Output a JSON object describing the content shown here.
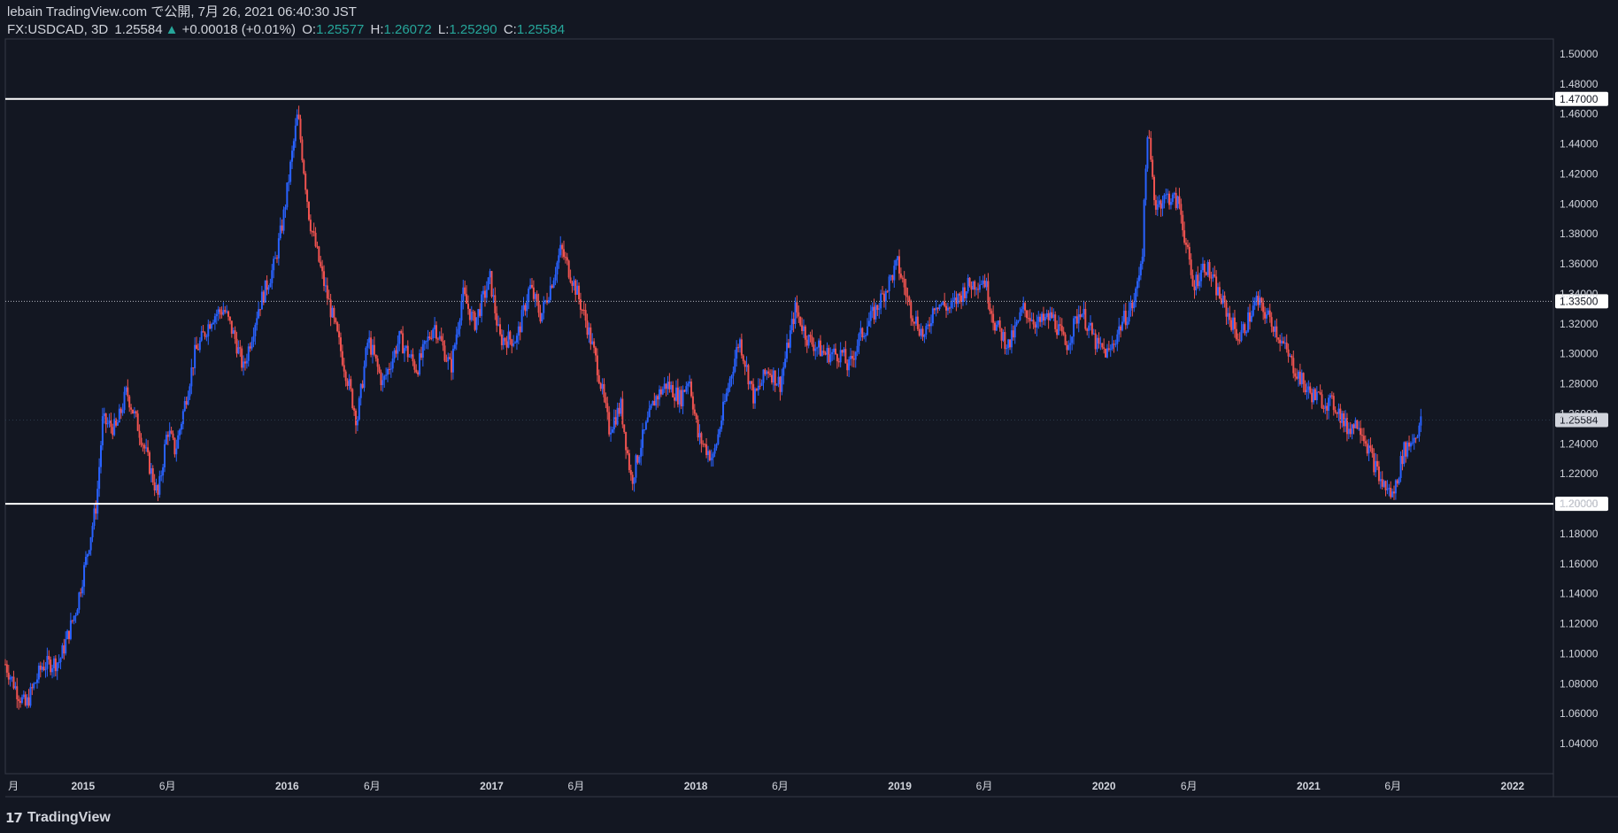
{
  "header": {
    "publish_line": "lebain TradingView.com で公開, 7月 26, 2021 06:40:30 JST",
    "symbol": "FX:USDCAD, 3D",
    "last": "1.25584",
    "change_arrow": "▲",
    "change": "+0.00018 (+0.01%)",
    "o_label": "O:",
    "o_val": "1.25577",
    "h_label": "H:",
    "h_val": "1.26072",
    "l_label": "L:",
    "l_val": "1.25290",
    "c_label": "C:",
    "c_val": "1.25584"
  },
  "footer": {
    "logo_text": "TradingView",
    "logo_icon": "tradingview-logo-icon"
  },
  "colors": {
    "background": "#131722",
    "up": "#2962ff",
    "down": "#ef5350",
    "grid": "#2a2e39",
    "text": "#d1d4dc"
  },
  "chart_data": {
    "type": "candlestick",
    "symbol": "FX:USDCAD",
    "interval": "3D",
    "ylim": [
      1.02,
      1.51
    ],
    "xlim": [
      "2014-08-15",
      "2022-03-15"
    ],
    "y_ticks": [
      "1.04000",
      "1.06000",
      "1.08000",
      "1.10000",
      "1.12000",
      "1.14000",
      "1.16000",
      "1.18000",
      "1.20000",
      "1.22000",
      "1.24000",
      "1.26000",
      "1.28000",
      "1.30000",
      "1.32000",
      "1.34000",
      "1.36000",
      "1.38000",
      "1.40000",
      "1.42000",
      "1.44000",
      "1.46000",
      "1.48000",
      "1.50000"
    ],
    "x_ticks": [
      {
        "date": "2014-08-20",
        "label": "月"
      },
      {
        "date": "2015-01-01",
        "label": "2015"
      },
      {
        "date": "2015-06-01",
        "label": "6月"
      },
      {
        "date": "2016-01-01",
        "label": "2016"
      },
      {
        "date": "2016-06-01",
        "label": "6月"
      },
      {
        "date": "2017-01-01",
        "label": "2017"
      },
      {
        "date": "2017-06-01",
        "label": "6月"
      },
      {
        "date": "2018-01-01",
        "label": "2018"
      },
      {
        "date": "2018-06-01",
        "label": "6月"
      },
      {
        "date": "2019-01-01",
        "label": "2019"
      },
      {
        "date": "2019-06-01",
        "label": "6月"
      },
      {
        "date": "2020-01-01",
        "label": "2020"
      },
      {
        "date": "2020-06-01",
        "label": "6月"
      },
      {
        "date": "2021-01-01",
        "label": "2021"
      },
      {
        "date": "2021-06-01",
        "label": "6月"
      },
      {
        "date": "2022-01-01",
        "label": "2022"
      }
    ],
    "horizontal_lines": [
      {
        "price": 1.47,
        "label": "1.47000",
        "style": "solid"
      },
      {
        "price": 1.335,
        "label": "1.33500",
        "style": "dotted"
      },
      {
        "price": 1.2,
        "label": "1.20000",
        "style": "solid"
      }
    ],
    "last_price": {
      "price": 1.25584,
      "label": "1.25584"
    },
    "path_points": [
      [
        "2014-08-15",
        1.093
      ],
      [
        "2014-09-05",
        1.075
      ],
      [
        "2014-09-20",
        1.065
      ],
      [
        "2014-10-20",
        1.092
      ],
      [
        "2014-11-20",
        1.095
      ],
      [
        "2014-12-20",
        1.13
      ],
      [
        "2015-01-05",
        1.16
      ],
      [
        "2015-01-25",
        1.2
      ],
      [
        "2015-02-05",
        1.255
      ],
      [
        "2015-03-01",
        1.25
      ],
      [
        "2015-03-20",
        1.275
      ],
      [
        "2015-04-15",
        1.245
      ],
      [
        "2015-05-15",
        1.205
      ],
      [
        "2015-06-01",
        1.25
      ],
      [
        "2015-06-15",
        1.235
      ],
      [
        "2015-07-20",
        1.3
      ],
      [
        "2015-08-20",
        1.325
      ],
      [
        "2015-09-10",
        1.33
      ],
      [
        "2015-09-30",
        1.31
      ],
      [
        "2015-10-15",
        1.29
      ],
      [
        "2015-11-10",
        1.33
      ],
      [
        "2015-12-10",
        1.36
      ],
      [
        "2015-12-25",
        1.39
      ],
      [
        "2016-01-20",
        1.46
      ],
      [
        "2016-02-10",
        1.39
      ],
      [
        "2016-03-05",
        1.35
      ],
      [
        "2016-04-01",
        1.31
      ],
      [
        "2016-04-20",
        1.28
      ],
      [
        "2016-05-05",
        1.255
      ],
      [
        "2016-05-25",
        1.31
      ],
      [
        "2016-06-20",
        1.28
      ],
      [
        "2016-07-20",
        1.31
      ],
      [
        "2016-08-20",
        1.29
      ],
      [
        "2016-09-20",
        1.32
      ],
      [
        "2016-10-20",
        1.29
      ],
      [
        "2016-11-10",
        1.34
      ],
      [
        "2016-12-01",
        1.32
      ],
      [
        "2016-12-29",
        1.35
      ],
      [
        "2017-01-15",
        1.31
      ],
      [
        "2017-02-15",
        1.31
      ],
      [
        "2017-03-10",
        1.345
      ],
      [
        "2017-03-30",
        1.325
      ],
      [
        "2017-04-20",
        1.35
      ],
      [
        "2017-05-05",
        1.37
      ],
      [
        "2017-05-30",
        1.345
      ],
      [
        "2017-06-20",
        1.32
      ],
      [
        "2017-07-10",
        1.29
      ],
      [
        "2017-07-30",
        1.25
      ],
      [
        "2017-08-20",
        1.265
      ],
      [
        "2017-09-08",
        1.215
      ],
      [
        "2017-09-25",
        1.24
      ],
      [
        "2017-10-20",
        1.27
      ],
      [
        "2017-11-10",
        1.28
      ],
      [
        "2017-12-05",
        1.27
      ],
      [
        "2017-12-20",
        1.285
      ],
      [
        "2018-01-05",
        1.245
      ],
      [
        "2018-02-01",
        1.23
      ],
      [
        "2018-03-01",
        1.28
      ],
      [
        "2018-03-20",
        1.31
      ],
      [
        "2018-04-15",
        1.27
      ],
      [
        "2018-05-10",
        1.29
      ],
      [
        "2018-06-01",
        1.28
      ],
      [
        "2018-06-28",
        1.33
      ],
      [
        "2018-07-20",
        1.31
      ],
      [
        "2018-08-20",
        1.3
      ],
      [
        "2018-09-20",
        1.3
      ],
      [
        "2018-10-01",
        1.29
      ],
      [
        "2018-10-20",
        1.31
      ],
      [
        "2018-11-20",
        1.33
      ],
      [
        "2018-12-28",
        1.36
      ],
      [
        "2019-01-20",
        1.33
      ],
      [
        "2019-02-15",
        1.31
      ],
      [
        "2019-03-05",
        1.335
      ],
      [
        "2019-04-01",
        1.33
      ],
      [
        "2019-05-01",
        1.345
      ],
      [
        "2019-06-01",
        1.35
      ],
      [
        "2019-06-20",
        1.32
      ],
      [
        "2019-07-15",
        1.305
      ],
      [
        "2019-08-10",
        1.33
      ],
      [
        "2019-09-05",
        1.32
      ],
      [
        "2019-10-01",
        1.325
      ],
      [
        "2019-10-25",
        1.305
      ],
      [
        "2019-11-20",
        1.33
      ],
      [
        "2019-12-20",
        1.305
      ],
      [
        "2020-01-10",
        1.3
      ],
      [
        "2020-02-01",
        1.32
      ],
      [
        "2020-02-25",
        1.335
      ],
      [
        "2020-03-10",
        1.37
      ],
      [
        "2020-03-19",
        1.45
      ],
      [
        "2020-04-01",
        1.4
      ],
      [
        "2020-04-25",
        1.405
      ],
      [
        "2020-05-15",
        1.4
      ],
      [
        "2020-06-08",
        1.345
      ],
      [
        "2020-06-30",
        1.36
      ],
      [
        "2020-07-30",
        1.335
      ],
      [
        "2020-08-30",
        1.31
      ],
      [
        "2020-09-30",
        1.335
      ],
      [
        "2020-10-30",
        1.32
      ],
      [
        "2020-11-30",
        1.295
      ],
      [
        "2020-12-30",
        1.275
      ],
      [
        "2021-01-20",
        1.27
      ],
      [
        "2021-02-20",
        1.265
      ],
      [
        "2021-03-10",
        1.25
      ],
      [
        "2021-04-01",
        1.255
      ],
      [
        "2021-04-20",
        1.235
      ],
      [
        "2021-05-10",
        1.215
      ],
      [
        "2021-06-01",
        1.205
      ],
      [
        "2021-06-20",
        1.235
      ],
      [
        "2021-07-10",
        1.245
      ],
      [
        "2021-07-23",
        1.25584
      ]
    ]
  }
}
